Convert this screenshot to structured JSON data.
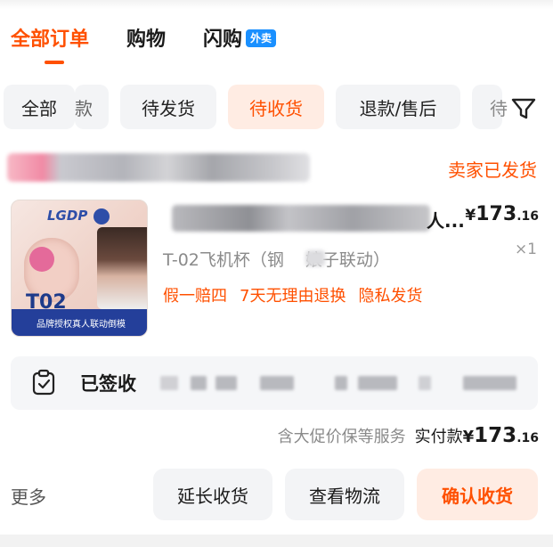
{
  "main_tabs": [
    {
      "label": "全部订单",
      "active": true
    },
    {
      "label": "购物",
      "active": false
    },
    {
      "label": "闪购",
      "active": false,
      "badge": "外卖"
    }
  ],
  "filter_chips": [
    {
      "label": "全部"
    },
    {
      "label": "款"
    },
    {
      "label": "待发货"
    },
    {
      "label": "待收货",
      "active": true
    },
    {
      "label": "退款/售后"
    },
    {
      "label": "待"
    }
  ],
  "filter_icon": "funnel-icon",
  "order": {
    "shop_status": "卖家已发货",
    "product": {
      "title_visible_tail": "人...",
      "price": {
        "currency": "¥",
        "integer": "173",
        "decimal": ".16"
      },
      "quantity": "×1",
      "spec_left": "T-02飞机杯（钢",
      "spec_right": "娘子联动）",
      "services": [
        "假一赔四",
        "7天无理由退换",
        "隐私发货"
      ],
      "thumbnail": {
        "brand": "LGDP",
        "model": "T02",
        "strip_text": "品牌授权真人联动倒模"
      }
    },
    "logistics": {
      "status": "已签收",
      "icon": "clipboard-check-icon"
    },
    "totals": {
      "note": "含大促价保等服务",
      "paid_label": "实付款",
      "currency": "¥",
      "integer": "173",
      "decimal": ".16"
    },
    "actions": {
      "more": "更多",
      "extend": "延长收货",
      "logistics": "查看物流",
      "confirm": "确认收货"
    }
  },
  "colors": {
    "accent": "#ff5000",
    "accent_bg": "#ffece3",
    "chip_bg": "#f3f4f6",
    "badge_blue": "#1a90ff"
  }
}
